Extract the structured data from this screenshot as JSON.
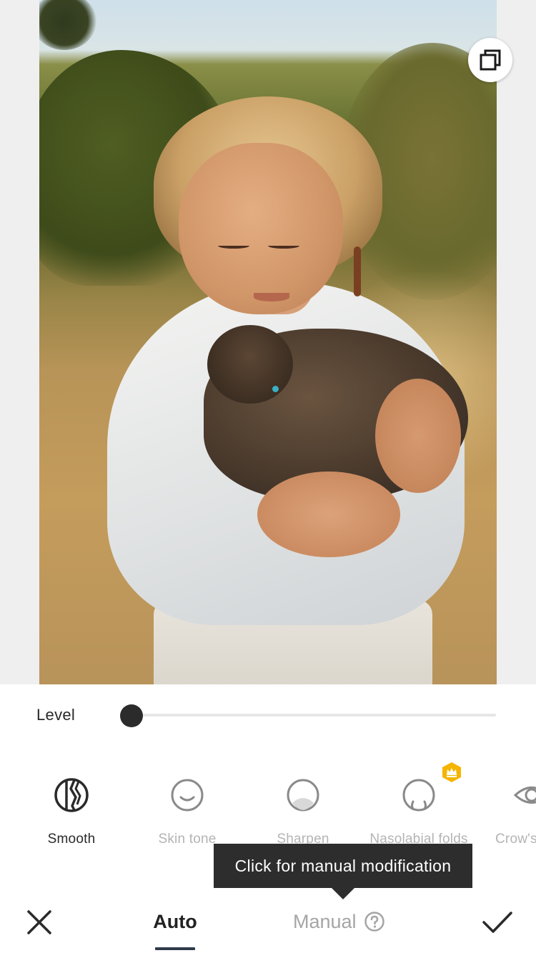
{
  "photo": {
    "compare_icon": "compare-layers-icon"
  },
  "level": {
    "label": "Level",
    "value": 0
  },
  "tools": [
    {
      "label": "Smooth",
      "icon": "smooth-icon",
      "active": true,
      "premium": false
    },
    {
      "label": "Skin tone",
      "icon": "skin-tone-icon",
      "active": false,
      "premium": false
    },
    {
      "label": "Sharpen",
      "icon": "sharpen-icon",
      "active": false,
      "premium": false
    },
    {
      "label": "Nasolabial folds",
      "icon": "nasolabial-folds-icon",
      "active": false,
      "premium": true
    },
    {
      "label": "Crow's",
      "icon": "eye-icon",
      "active": false,
      "premium": false
    }
  ],
  "tooltip": {
    "text": "Click for manual modification"
  },
  "bottom_bar": {
    "close_icon": "close-icon",
    "confirm_icon": "checkmark-icon",
    "modes": [
      {
        "label": "Auto",
        "active": true
      },
      {
        "label": "Manual",
        "active": false
      }
    ],
    "help_icon": "help-circle-icon"
  },
  "colors": {
    "accent": "#2f3a4c",
    "premium": "#f5b400",
    "text_dark": "#2a2a2a",
    "text_muted": "#b4b4b4",
    "tooltip_bg": "#2d2d2d"
  }
}
